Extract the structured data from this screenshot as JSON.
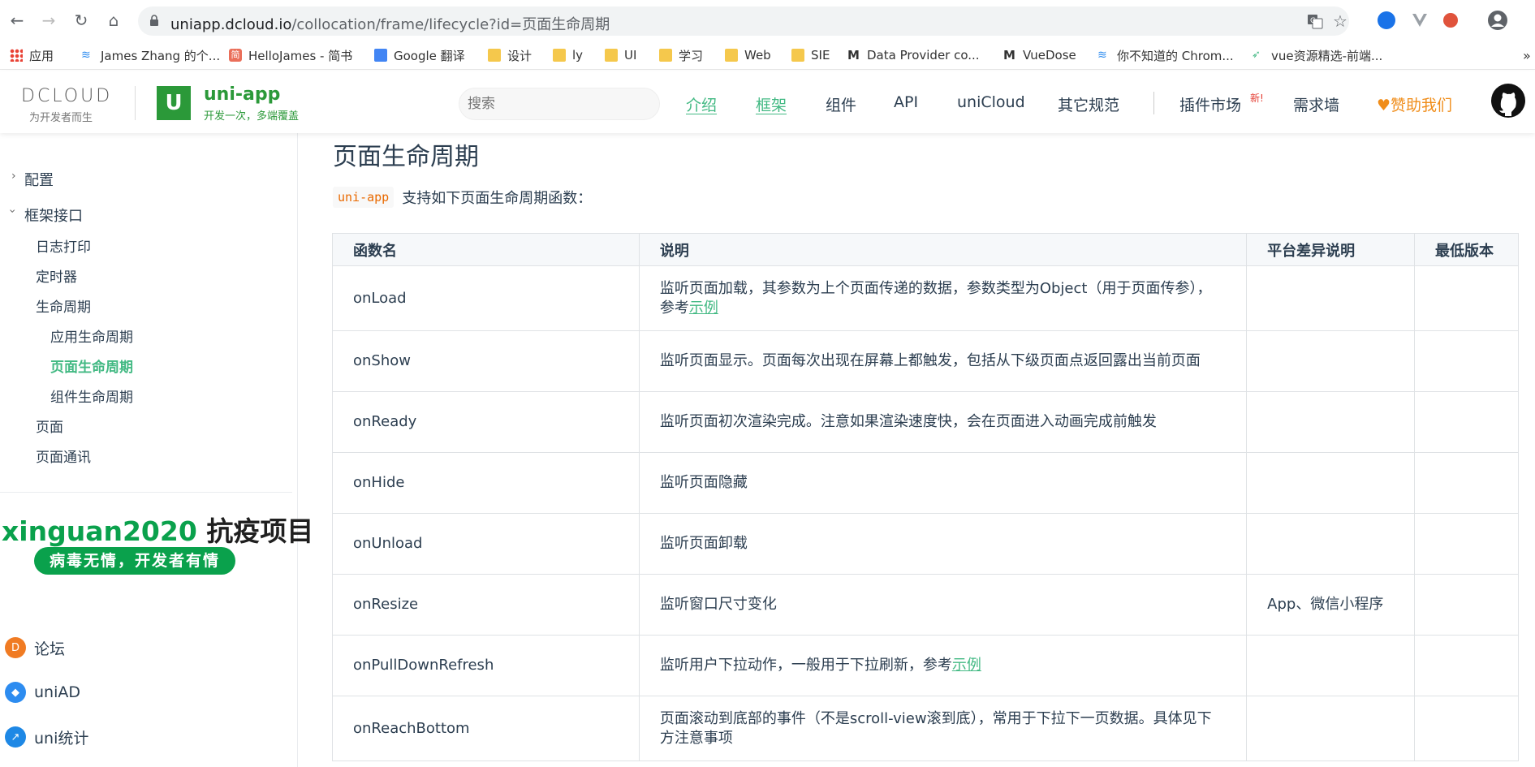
{
  "browser": {
    "url_host": "uniapp.dcloud.io",
    "url_path": "/collocation/frame/lifecycle?id=页面生命周期",
    "bookmarks": [
      {
        "label": "应用",
        "icon": "apps-grid-icon"
      },
      {
        "label": "James Zhang 的个...",
        "icon": "dcloud-icon"
      },
      {
        "label": "HelloJames - 简书",
        "icon": "jianshu-icon"
      },
      {
        "label": "Google 翻译",
        "icon": "translate-icon"
      },
      {
        "label": "设计",
        "icon": "folder-icon"
      },
      {
        "label": "ly",
        "icon": "folder-icon"
      },
      {
        "label": "UI",
        "icon": "folder-icon"
      },
      {
        "label": "学习",
        "icon": "folder-icon"
      },
      {
        "label": "Web",
        "icon": "folder-icon"
      },
      {
        "label": "SIE",
        "icon": "folder-icon"
      },
      {
        "label": "Data Provider co...",
        "icon": "gmail-icon"
      },
      {
        "label": "VueDose",
        "icon": "vuedose-icon"
      },
      {
        "label": "你不知道的 Chrom...",
        "icon": "dcloud-icon"
      },
      {
        "label": "vue资源精选-前端...",
        "icon": "bird-icon"
      }
    ],
    "more": "»"
  },
  "header": {
    "dcloud_logo": "DCLOUD",
    "dcloud_slogan": "为开发者而生",
    "uni_logo": "U",
    "uni_title": "uni-app",
    "uni_slogan": "开发一次，多端覆盖",
    "search_placeholder": "搜索",
    "nav": [
      {
        "label": "介绍",
        "active": true
      },
      {
        "label": "框架",
        "active": true
      },
      {
        "label": "组件",
        "active": false
      },
      {
        "label": "API",
        "active": false
      },
      {
        "label": "uniCloud",
        "active": false
      },
      {
        "label": "其它规范",
        "active": false
      }
    ],
    "plugin_market": "插件市场",
    "new_badge": "新!",
    "demand_wall": "需求墙",
    "sponsor": "♥赞助我们"
  },
  "sidebar": {
    "config": "配置",
    "framework_api": "框架接口",
    "items": {
      "log": "日志打印",
      "timer": "定时器",
      "lifecycle": "生命周期",
      "app_lifecycle": "应用生命周期",
      "page_lifecycle": "页面生命周期",
      "component_lifecycle": "组件生命周期",
      "page": "页面",
      "page_comm": "页面通讯"
    },
    "promo_en": "xinguan2020",
    "promo_cn": " 抗疫项目",
    "promo_pill": "病毒无情，开发者有情",
    "links": [
      {
        "label": "论坛",
        "color": "#f07b23"
      },
      {
        "label": "uniAD",
        "color": "#2d8cf0"
      },
      {
        "label": "uni统计",
        "color": "#1e88e5"
      }
    ]
  },
  "content": {
    "title": "页面生命周期",
    "intro_code": "uni-app",
    "intro_text": "支持如下页面生命周期函数：",
    "table_headers": [
      "函数名",
      "说明",
      "平台差异说明",
      "最低版本"
    ],
    "rows": [
      {
        "name": "onLoad",
        "desc": "监听页面加载，其参数为上个页面传递的数据，参数类型为Object（用于页面传参），参考",
        "link": "示例",
        "platform": "",
        "version": ""
      },
      {
        "name": "onShow",
        "desc": "监听页面显示。页面每次出现在屏幕上都触发，包括从下级页面点返回露出当前页面",
        "link": "",
        "platform": "",
        "version": ""
      },
      {
        "name": "onReady",
        "desc": "监听页面初次渲染完成。注意如果渲染速度快，会在页面进入动画完成前触发",
        "link": "",
        "platform": "",
        "version": ""
      },
      {
        "name": "onHide",
        "desc": "监听页面隐藏",
        "link": "",
        "platform": "",
        "version": ""
      },
      {
        "name": "onUnload",
        "desc": "监听页面卸载",
        "link": "",
        "platform": "",
        "version": ""
      },
      {
        "name": "onResize",
        "desc": "监听窗口尺寸变化",
        "link": "",
        "platform": "App、微信小程序",
        "version": ""
      },
      {
        "name": "onPullDownRefresh",
        "desc": "监听用户下拉动作，一般用于下拉刷新，参考",
        "link": "示例",
        "platform": "",
        "version": ""
      },
      {
        "name": "onReachBottom",
        "desc": "页面滚动到底部的事件（不是scroll-view滚到底），常用于下拉下一页数据。具体见下方注意事项",
        "link": "",
        "platform": "",
        "version": ""
      }
    ]
  },
  "colors": {
    "accent": "#42b983",
    "brand_green": "#2b9939",
    "promo_green": "#0aa14c",
    "sponsor_orange": "#f08d1a"
  }
}
